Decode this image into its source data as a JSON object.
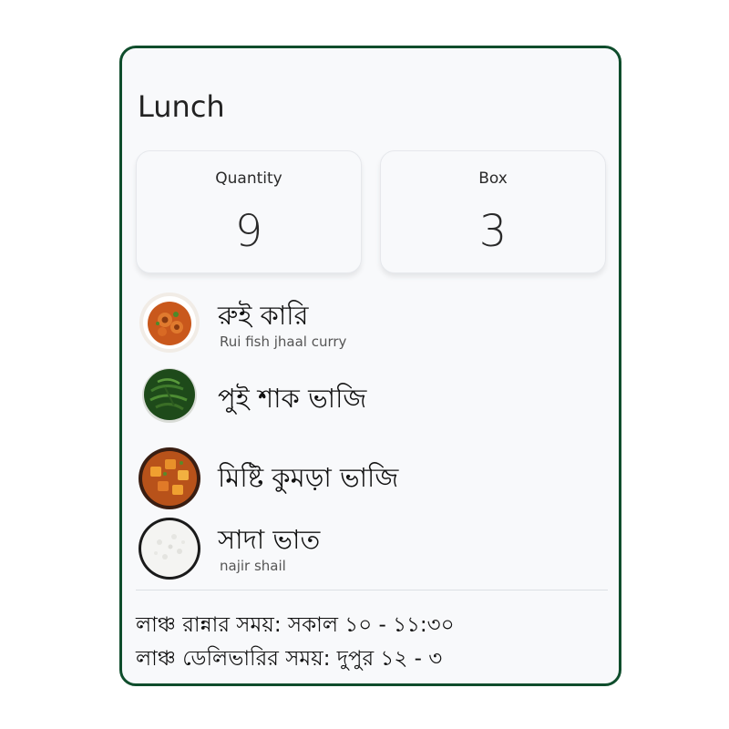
{
  "card": {
    "title": "Lunch",
    "border_color": "#0f4d2c"
  },
  "stats": [
    {
      "label": "Quantity",
      "value": "9"
    },
    {
      "label": "Box",
      "value": "3"
    }
  ],
  "items": [
    {
      "name": "রুই কারি",
      "subtitle": "Rui fish jhaal curry",
      "icon": "fish-curry-bowl-icon"
    },
    {
      "name": "পুই শাক ভাজি",
      "subtitle": "",
      "icon": "greens-bowl-icon"
    },
    {
      "name": "মিষ্টি কুমড়া ভাজি",
      "subtitle": "",
      "icon": "pumpkin-bowl-icon"
    },
    {
      "name": "সাদা ভাত",
      "subtitle": "najir shail",
      "icon": "rice-bowl-icon"
    }
  ],
  "timing": {
    "cooking": "লাঞ্চ রান্নার সময়: সকাল ১০ - ১১:৩০",
    "delivery": "লাঞ্চ ডেলিভারির সময়: দুপুর ১২ - ৩"
  }
}
